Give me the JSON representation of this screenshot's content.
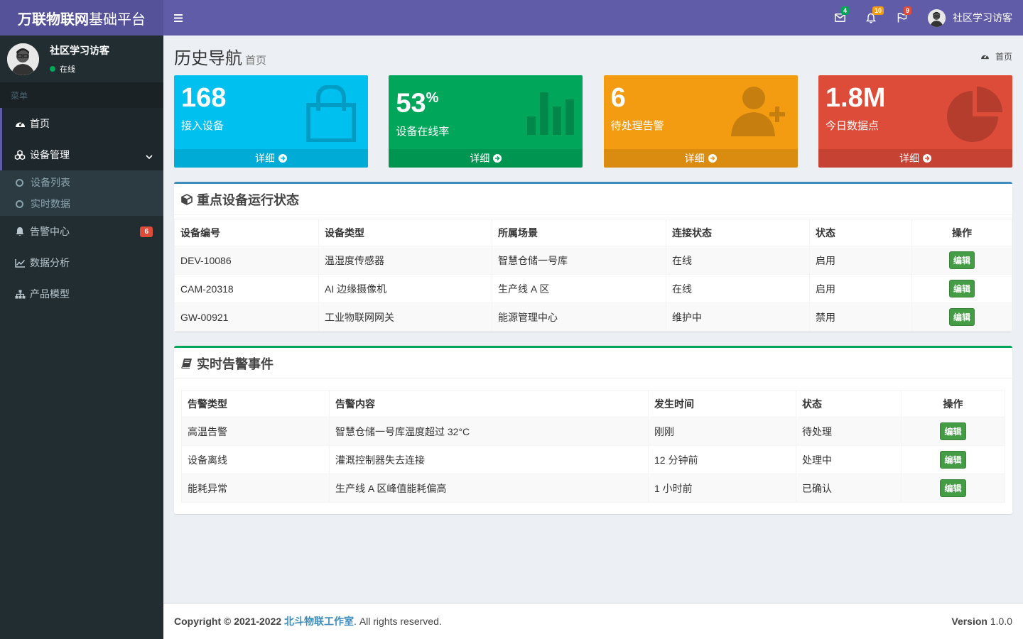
{
  "brand": {
    "bold": "万联物联网",
    "rest": "基础平台"
  },
  "navbar": {
    "badges": {
      "mail": "4",
      "bell": "10",
      "flag": "9"
    },
    "badge_colors": {
      "mail": "#00a65a",
      "bell": "#f39c12",
      "flag": "#dd4b39"
    },
    "user_name": "社区学习访客"
  },
  "sidebar": {
    "user_name": "社区学习访客",
    "user_status": "在线",
    "menu_header": "菜单",
    "items": [
      {
        "label": "首页",
        "icon": "dashboard-icon"
      },
      {
        "label": "设备管理",
        "icon": "cubes-icon"
      },
      {
        "label": "告警中心",
        "icon": "bell-icon",
        "badge": "6"
      },
      {
        "label": "数据分析",
        "icon": "line-chart-icon"
      },
      {
        "label": "产品模型",
        "icon": "sitemap-icon"
      }
    ],
    "submenu": [
      {
        "label": "设备列表"
      },
      {
        "label": "实时数据"
      }
    ]
  },
  "content_header": {
    "title": "历史导航",
    "subtitle": "首页",
    "breadcrumb": "首页"
  },
  "stat_boxes": [
    {
      "value": "168",
      "sup": "",
      "label": "接入设备",
      "footer": "详细",
      "color": "#00c0ef",
      "icon": "shopping-bag-icon"
    },
    {
      "value": "53",
      "sup": "%",
      "label": "设备在线率",
      "footer": "详细",
      "color": "#00a65a",
      "icon": "bar-chart-icon"
    },
    {
      "value": "6",
      "sup": "",
      "label": "待处理告警",
      "footer": "详细",
      "color": "#f39c12",
      "icon": "user-plus-icon"
    },
    {
      "value": "1.8M",
      "sup": "",
      "label": "今日数据点",
      "footer": "详细",
      "color": "#dd4b39",
      "icon": "pie-chart-icon"
    }
  ],
  "device_table": {
    "title": "重点设备运行状态",
    "headers": [
      "设备编号",
      "设备类型",
      "所属场景",
      "连接状态",
      "状态",
      "操作"
    ],
    "rows": [
      [
        "DEV-10086",
        "温湿度传感器",
        "智慧仓储一号库",
        "在线",
        "启用",
        "编辑"
      ],
      [
        "CAM-20318",
        "AI 边缘摄像机",
        "生产线 A 区",
        "在线",
        "启用",
        "编辑"
      ],
      [
        "GW-00921",
        "工业物联网网关",
        "能源管理中心",
        "维护中",
        "禁用",
        "编辑"
      ]
    ]
  },
  "alarm_table": {
    "title": "实时告警事件",
    "headers": [
      "告警类型",
      "告警内容",
      "发生时间",
      "状态",
      "操作"
    ],
    "rows": [
      [
        "高温告警",
        "智慧仓储一号库温度超过 32°C",
        "刚刚",
        "待处理",
        "编辑"
      ],
      [
        "设备离线",
        "灌溉控制器失去连接",
        "12 分钟前",
        "处理中",
        "编辑"
      ],
      [
        "能耗异常",
        "生产线 A 区峰值能耗偏高",
        "1 小时前",
        "已确认",
        "编辑"
      ]
    ]
  },
  "footer": {
    "copyright_prefix": "Copyright © 2021-2022 ",
    "company": "北斗物联工作室",
    "copyright_suffix": ". All rights reserved.",
    "version_label": "Version",
    "version": "1.0.0"
  }
}
